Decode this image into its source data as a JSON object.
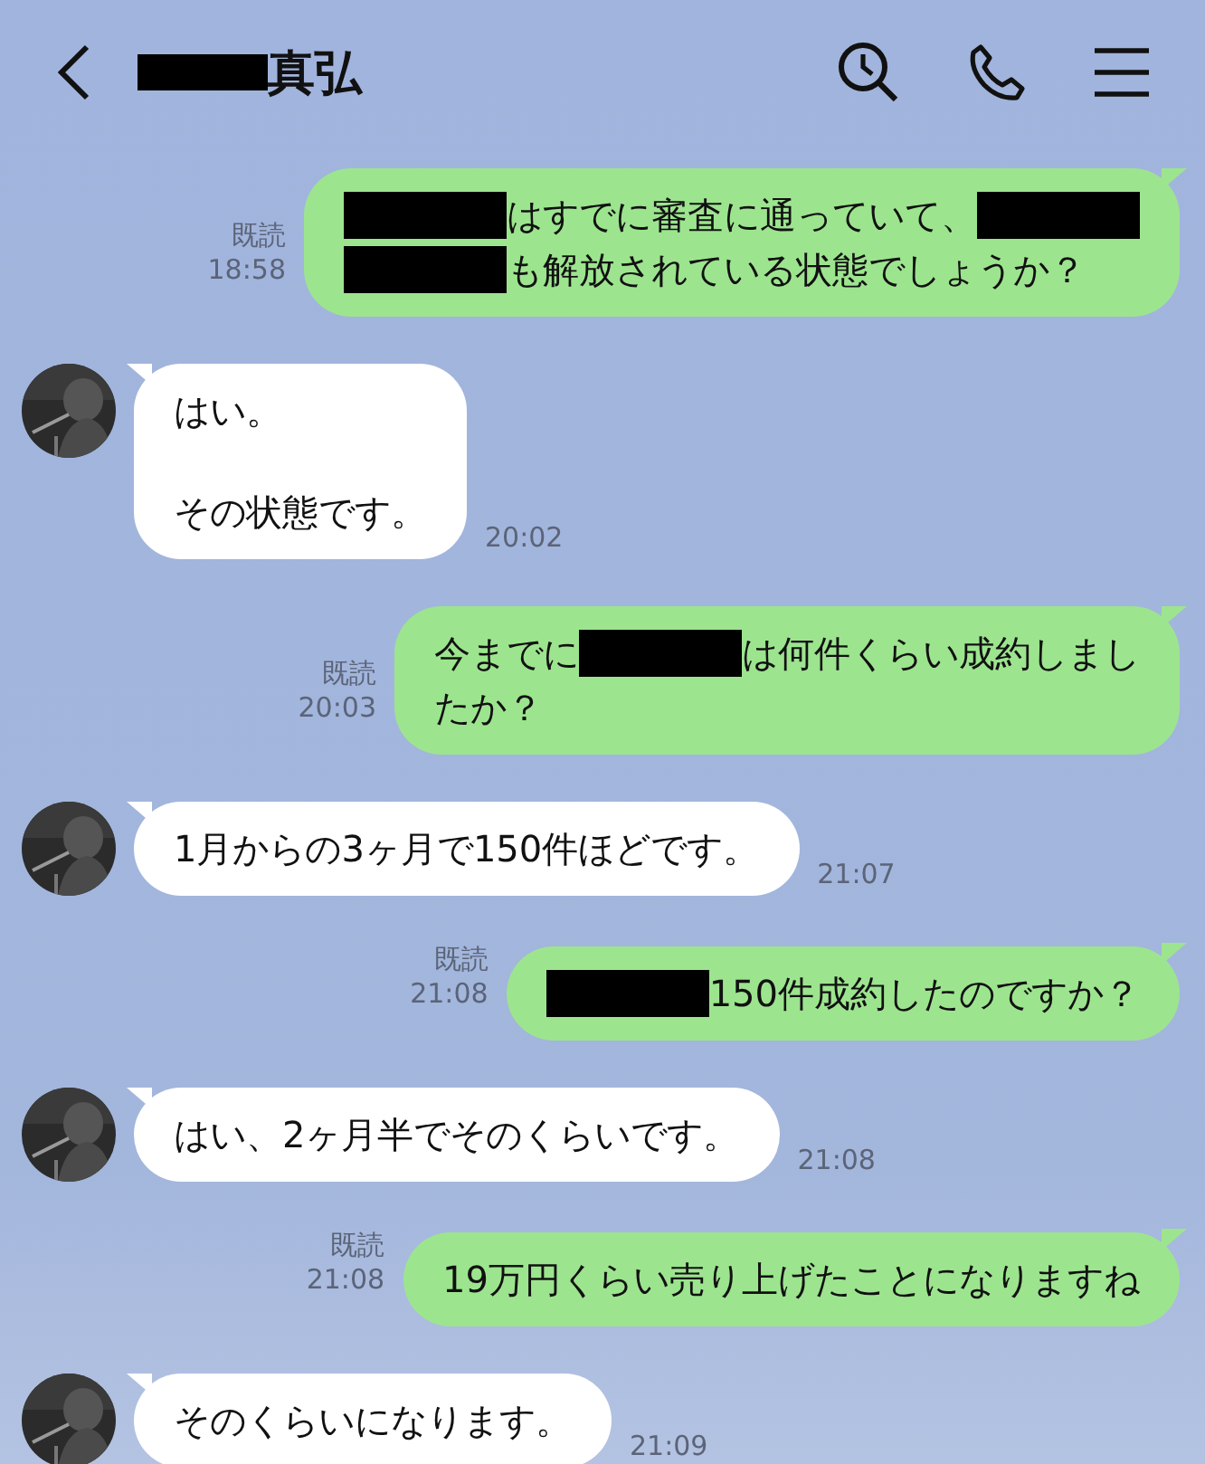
{
  "header": {
    "title_segments": [
      {
        "kind": "redacted"
      },
      {
        "kind": "text",
        "text": "真弘"
      }
    ]
  },
  "messages": [
    {
      "kind": "sent",
      "read_label": "既読",
      "time": "18:58",
      "lines": [
        {
          "kind": "text",
          "segments": [
            {
              "kind": "redacted"
            },
            {
              "kind": "text",
              "text": "はすでに審査に通っていて、"
            },
            {
              "kind": "redacted"
            }
          ]
        },
        {
          "kind": "text",
          "segments": [
            {
              "kind": "redacted"
            },
            {
              "kind": "text",
              "text": "も解放されている状態でしょうか？"
            }
          ]
        }
      ]
    },
    {
      "kind": "received",
      "time": "20:02",
      "lines": [
        {
          "kind": "text",
          "segments": [
            {
              "kind": "text",
              "text": "はい。"
            }
          ]
        },
        {
          "kind": "blank"
        },
        {
          "kind": "text",
          "segments": [
            {
              "kind": "text",
              "text": "その状態です。"
            }
          ]
        }
      ]
    },
    {
      "kind": "sent",
      "read_label": "既読",
      "time": "20:03",
      "lines": [
        {
          "kind": "text",
          "segments": [
            {
              "kind": "text",
              "text": "今までに"
            },
            {
              "kind": "redacted"
            },
            {
              "kind": "text",
              "text": "は何件くらい成約しまし"
            }
          ]
        },
        {
          "kind": "text",
          "segments": [
            {
              "kind": "text",
              "text": "たか？"
            }
          ]
        }
      ]
    },
    {
      "kind": "received",
      "time": "21:07",
      "lines": [
        {
          "kind": "text",
          "segments": [
            {
              "kind": "text",
              "text": "1月からの3ヶ月で150件ほどです。"
            }
          ]
        }
      ]
    },
    {
      "kind": "sent",
      "read_label": "既読",
      "time": "21:08",
      "lines": [
        {
          "kind": "text",
          "segments": [
            {
              "kind": "redacted"
            },
            {
              "kind": "text",
              "text": "150件成約したのですか？"
            }
          ]
        }
      ]
    },
    {
      "kind": "received",
      "time": "21:08",
      "lines": [
        {
          "kind": "text",
          "segments": [
            {
              "kind": "text",
              "text": "はい、2ヶ月半でそのくらいです。"
            }
          ]
        }
      ]
    },
    {
      "kind": "sent",
      "read_label": "既読",
      "time": "21:08",
      "lines": [
        {
          "kind": "text",
          "segments": [
            {
              "kind": "text",
              "text": "19万円くらい売り上げたことになりますね"
            }
          ]
        }
      ]
    },
    {
      "kind": "received",
      "time": "21:09",
      "lines": [
        {
          "kind": "text",
          "segments": [
            {
              "kind": "text",
              "text": "そのくらいになります。"
            }
          ]
        }
      ]
    }
  ]
}
